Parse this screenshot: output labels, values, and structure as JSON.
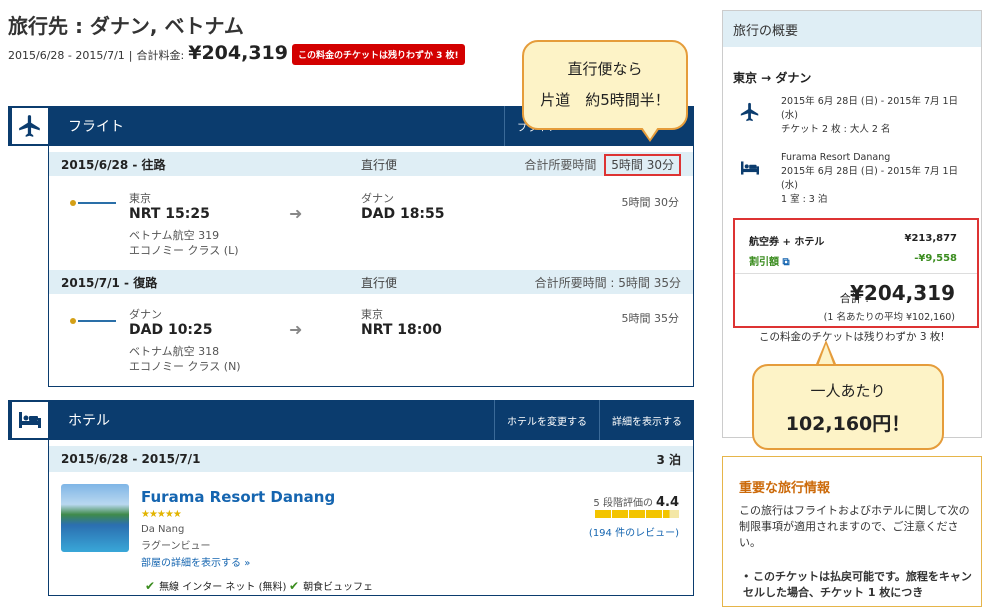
{
  "header": {
    "title": "旅行先 : ダナン, ベトナム",
    "date_range": "2015/6/28 - 2015/7/1",
    "separator": "|",
    "total_label": "合計料金:",
    "total_amount": "¥204,319",
    "scarcity_badge": "この料金のチケットは残りわずか 3 枚!"
  },
  "flight_section": {
    "label": "フライト",
    "button_partial": "フライト",
    "outbound": {
      "date_label": "2015/6/28 - 往路",
      "type": "直行便",
      "total_duration_label": "合計所要時間",
      "total_duration": "5時間 30分",
      "dep_city": "東京",
      "dep_time": "NRT 15:25",
      "airline_flight": "ベトナム航空 319",
      "cabin": "エコノミー クラス (L)",
      "arr_city": "ダナン",
      "arr_time": "DAD 18:55",
      "duration": "5時間 30分"
    },
    "return": {
      "date_label": "2015/7/1 - 復路",
      "type": "直行便",
      "total_duration": "合計所要時間 : 5時間 35分",
      "dep_city": "ダナン",
      "dep_time": "DAD 10:25",
      "airline_flight": "ベトナム航空 318",
      "cabin": "エコノミー クラス (N)",
      "arr_city": "東京",
      "arr_time": "NRT 18:00",
      "duration": "5時間 35分"
    }
  },
  "hotel_section": {
    "label": "ホテル",
    "change_button": "ホテルを変更する",
    "details_button": "詳細を表示する",
    "date_label": "2015/6/28 - 2015/7/1",
    "nights": "3 泊",
    "name": "Furama Resort Danang",
    "stars": "★★★★★",
    "location": "Da Nang",
    "room_view": "ラグーンビュー",
    "room_link": "部屋の詳細を表示する",
    "rating_label": "5 段階評価の",
    "rating_value": "4.4",
    "rating_fraction": 0.88,
    "reviews": "(194 件のレビュー)",
    "amenity_wifi": "無線 インター ネット (無料)",
    "amenity_breakfast": "朝食ビュッフェ"
  },
  "sidebar": {
    "heading": "旅行の概要",
    "route": "東京 → ダナン",
    "flight_dates": "2015年 6月 28日 (日) - 2015年 7月 1日 (水)",
    "flight_tickets": "チケット 2 枚 : 大人 2 名",
    "hotel_name": "Furama Resort Danang",
    "hotel_dates": "2015年 6月 28日 (日) - 2015年 7月 1日 (水)",
    "hotel_rooms": "1 室 : 3 泊",
    "package_label": "航空券 + ホテル",
    "package_price": "¥213,877",
    "discount_label": "割引額",
    "discount_value": "-¥9,558",
    "total_label": "合計 :",
    "total_value": "¥204,319",
    "per_person": "(1 名あたりの平均 ¥102,160)",
    "scarcity": "この料金のチケットは残りわずか 3 枚!"
  },
  "info_box": {
    "title": "重要な旅行情報",
    "text": "この旅行はフライトおよびホテルに関して次の制限事項が適用されますので、ご注意ください。",
    "bullet": "このチケットは払戻可能です。旅程をキャンセルした場合、チケット 1 枚につき"
  },
  "callouts": {
    "flight_line1": "直行便なら",
    "flight_line2": "片道　約5時間半！",
    "price_line1": "一人あたり",
    "price_line2": "102,160円！"
  },
  "colors": {
    "navy": "#0b3c6e",
    "header_light": "#dfeef5",
    "badge_red": "#d30000",
    "highlight_red": "#d33",
    "link_blue": "#1565b0",
    "discount_green": "#3a8c1e",
    "callout_bg": "#fdf3c7",
    "callout_border": "#e59c3b",
    "info_orange": "#cc6a0a"
  }
}
